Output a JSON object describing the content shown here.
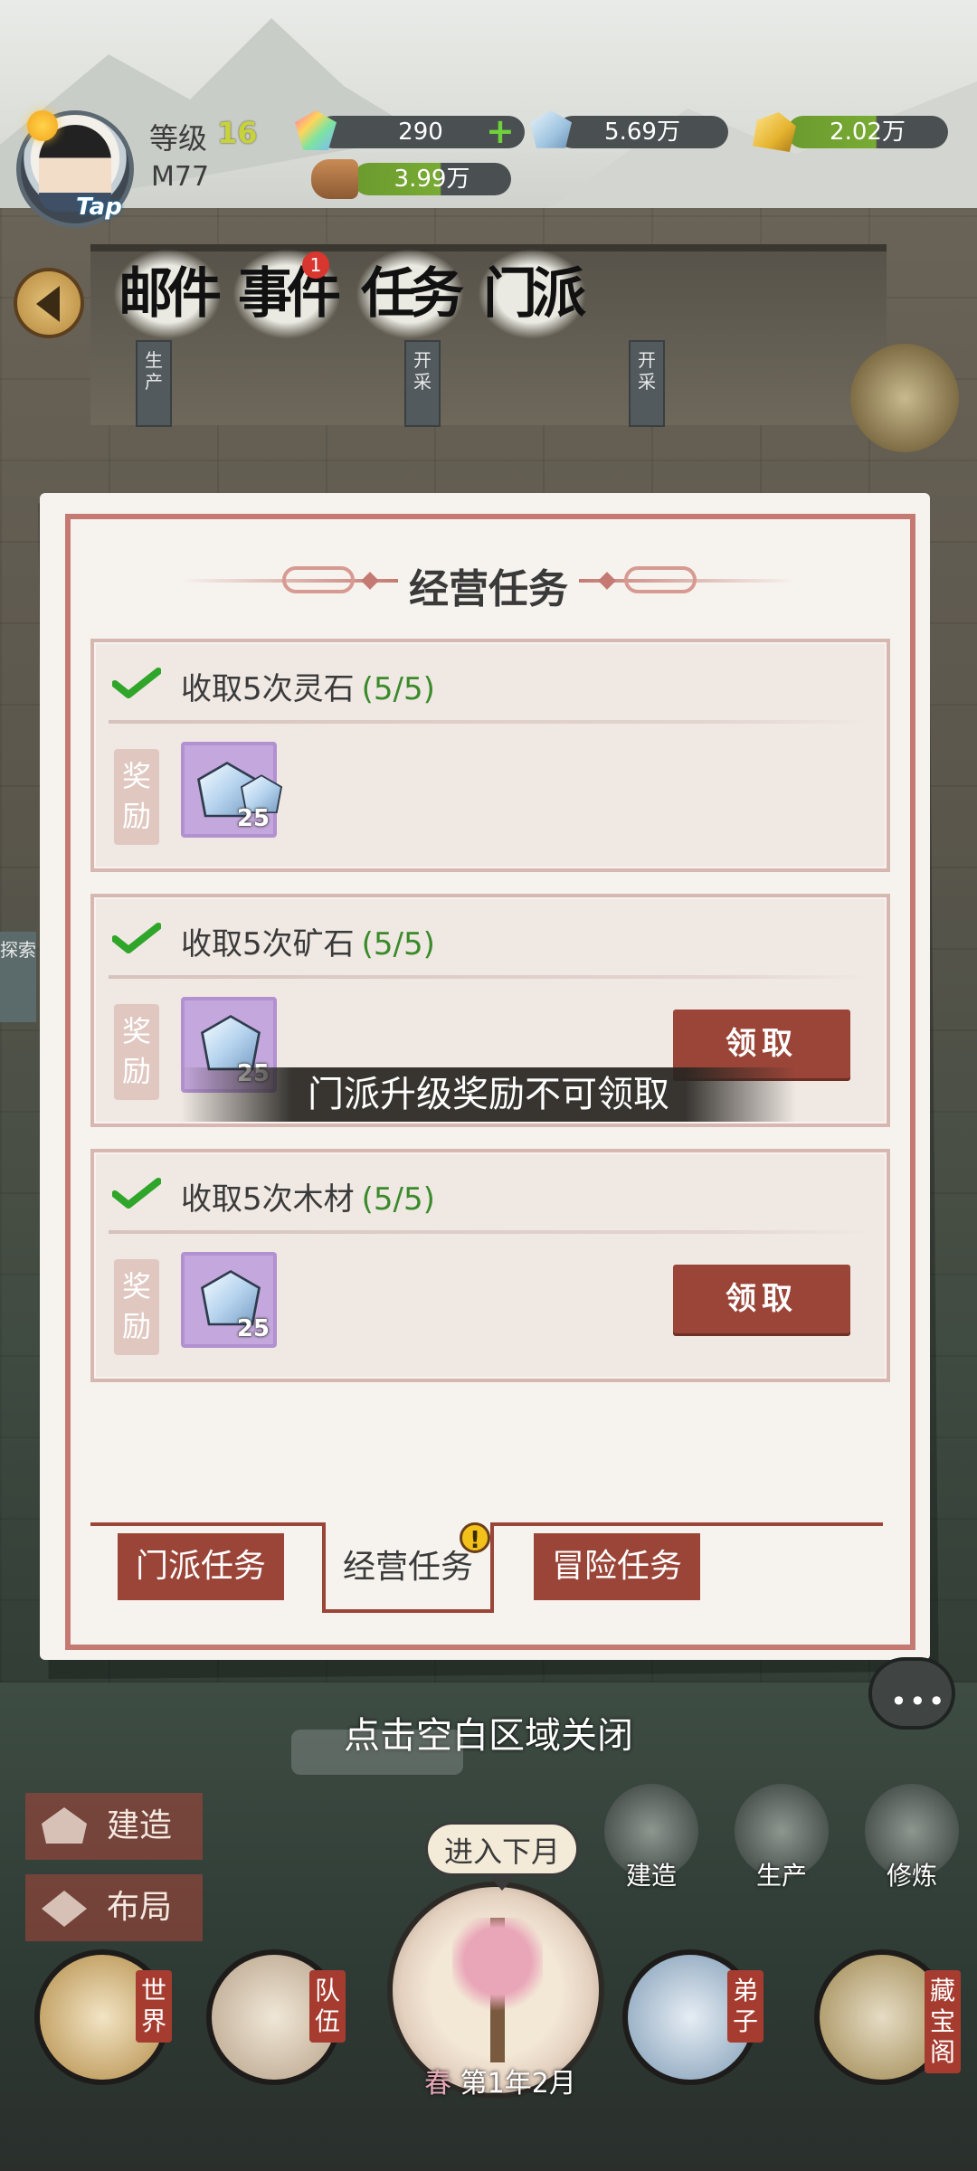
{
  "player": {
    "level_label": "等级",
    "level": "16",
    "name": "M77",
    "avatar_tap": "Tap"
  },
  "resources": {
    "spirit_stone": "290",
    "ore": "5.69万",
    "gold": "2.02万",
    "wood": "3.99万"
  },
  "top_nav": {
    "mail": "邮件",
    "events": "事件",
    "events_badge": "1",
    "tasks": "任务",
    "sect": "门派"
  },
  "scene_signs": {
    "produce": "生产",
    "mine_1": "开采",
    "mine_2": "开采",
    "explore": "探索"
  },
  "modal": {
    "title": "经营任务",
    "reward_label": "奖励",
    "tasks": [
      {
        "title": "收取5次灵石",
        "progress": "(5/5)",
        "reward_count": "25",
        "claim": null
      },
      {
        "title": "收取5次矿石",
        "progress": "(5/5)",
        "reward_count": "25",
        "claim": "领取"
      },
      {
        "title": "收取5次木材",
        "progress": "(5/5)",
        "reward_count": "25",
        "claim": "领取"
      }
    ],
    "toast": "门派升级奖励不可领取",
    "tabs": {
      "sect": "门派任务",
      "business": "经营任务",
      "adventure": "冒险任务",
      "business_alert": "!"
    }
  },
  "close_hint": "点击空白区域关闭",
  "hud": {
    "build": "建造",
    "layout": "布局",
    "quick_build": "建造",
    "quick_produce": "生产",
    "quick_cultivate": "修炼",
    "next_month": "进入下月",
    "season": "春",
    "date": "第1年2月",
    "world": "世界",
    "team": "队伍",
    "disciples": "弟子",
    "vault": "藏宝阁",
    "chat_dots": "•••"
  },
  "colors": {
    "accent_red": "#9a4538",
    "progress_green": "#3a8a2a",
    "reward_purple": "#c4a7dc"
  }
}
